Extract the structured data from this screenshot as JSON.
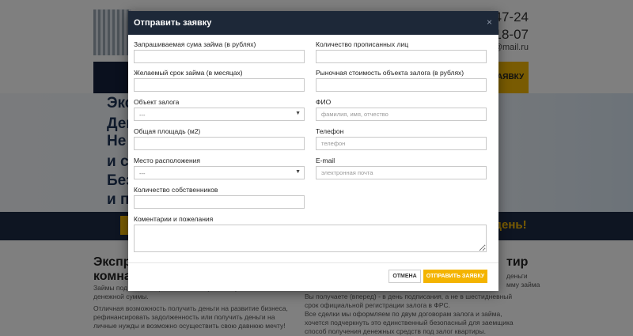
{
  "background": {
    "phones": [
      "0-47-24",
      "5-18-07"
    ],
    "email": "ali@mail.ru",
    "nav_button": "ЗАЯВКУ",
    "hero_lines": [
      "Экс",
      "Ден",
      "Не т",
      "и со",
      "Без",
      "и пр"
    ],
    "stripe_text": "1 день!",
    "left_heading": [
      "Экспре",
      "комнат"
    ],
    "right_heading": "тир",
    "left_paragraphs": [
      "Займы под                                                   та и быстрый способ получения нужной вам денежной суммы.",
      "Отличная возможность получить деньги на развитие бизнеса, рефинансировать задолженность или получить деньги на личные нужды и возможно осуществить свою давнюю мечту!"
    ],
    "right_paragraphs": [
      "деньги",
      "мму займа",
      "Вы получаете (вперед) - в день подписания, а не в шестидневный срок официальной регистрации залога в ФРС.",
      "Все сделки мы оформляем по двум договорам залога и займа, хочется подчеркнуть это единственный безопасный для заемщика способ получения денежных средств под залог квартиры."
    ]
  },
  "modal": {
    "title": "Отправить заявку",
    "close_glyph": "×",
    "fields": {
      "loan_amount": {
        "label": "Запрашиваемая сума займа (в рублях)",
        "value": ""
      },
      "registered_persons": {
        "label": "Количество прописанных лиц",
        "value": ""
      },
      "loan_term": {
        "label": "Желаемый срок займа (в месяцах)",
        "value": ""
      },
      "market_value": {
        "label": "Рыночная стоимость объекта залога (в рублях)",
        "value": ""
      },
      "collateral": {
        "label": "Объект залога",
        "selected": "---"
      },
      "full_name": {
        "label": "ФИО",
        "placeholder": "фамилия, имя, отчество"
      },
      "area": {
        "label": "Общая площадь (м2)",
        "value": ""
      },
      "phone": {
        "label": "Телефон",
        "placeholder": "телефон"
      },
      "location": {
        "label": "Место расположения",
        "selected": "---"
      },
      "email": {
        "label": "E-mail",
        "placeholder": "электронная почта"
      },
      "owners_count": {
        "label": "Количество собственников",
        "value": ""
      },
      "comments": {
        "label": "Коментарии и пожелания",
        "value": ""
      }
    },
    "buttons": {
      "cancel": "ОТМЕНА",
      "submit": "ОТПРАВИТЬ ЗАЯВКУ"
    }
  },
  "colors": {
    "accent": "#f4b400",
    "header": "#1d2838",
    "overlay": "rgba(0,0,0,0.5)"
  }
}
